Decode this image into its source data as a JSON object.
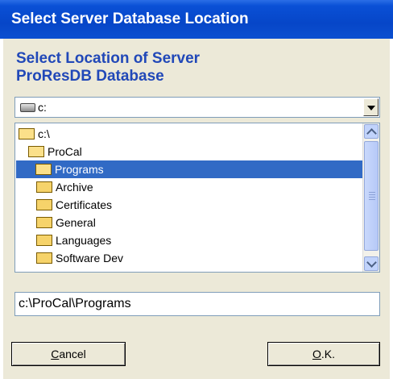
{
  "window": {
    "title": "Select Server Database Location"
  },
  "dialog": {
    "heading_line1": "Select Location of Server",
    "heading_line2": "ProResDB Database"
  },
  "drive_select": {
    "value": "c:",
    "icon": "drive-icon"
  },
  "tree": {
    "items": [
      {
        "label": "c:\\",
        "icon": "folder-open-icon",
        "selected": false
      },
      {
        "label": "ProCal",
        "icon": "folder-open-icon",
        "selected": false
      },
      {
        "label": "Programs",
        "icon": "folder-open-icon",
        "selected": true
      },
      {
        "label": "Archive",
        "icon": "folder-icon",
        "selected": false
      },
      {
        "label": "Certificates",
        "icon": "folder-icon",
        "selected": false
      },
      {
        "label": "General",
        "icon": "folder-icon",
        "selected": false
      },
      {
        "label": "Languages",
        "icon": "folder-icon",
        "selected": false
      },
      {
        "label": "Software Dev",
        "icon": "folder-icon",
        "selected": false
      }
    ]
  },
  "path_field": {
    "value": "c:\\ProCal\\Programs"
  },
  "buttons": {
    "cancel_mnemonic": "C",
    "cancel_rest": "ancel",
    "ok_mnemonic": "O",
    "ok_rest": ".K."
  },
  "colors": {
    "titlebar": "#0a50d6",
    "heading": "#2148b8",
    "selection": "#316ac5",
    "face": "#ece9d8"
  }
}
